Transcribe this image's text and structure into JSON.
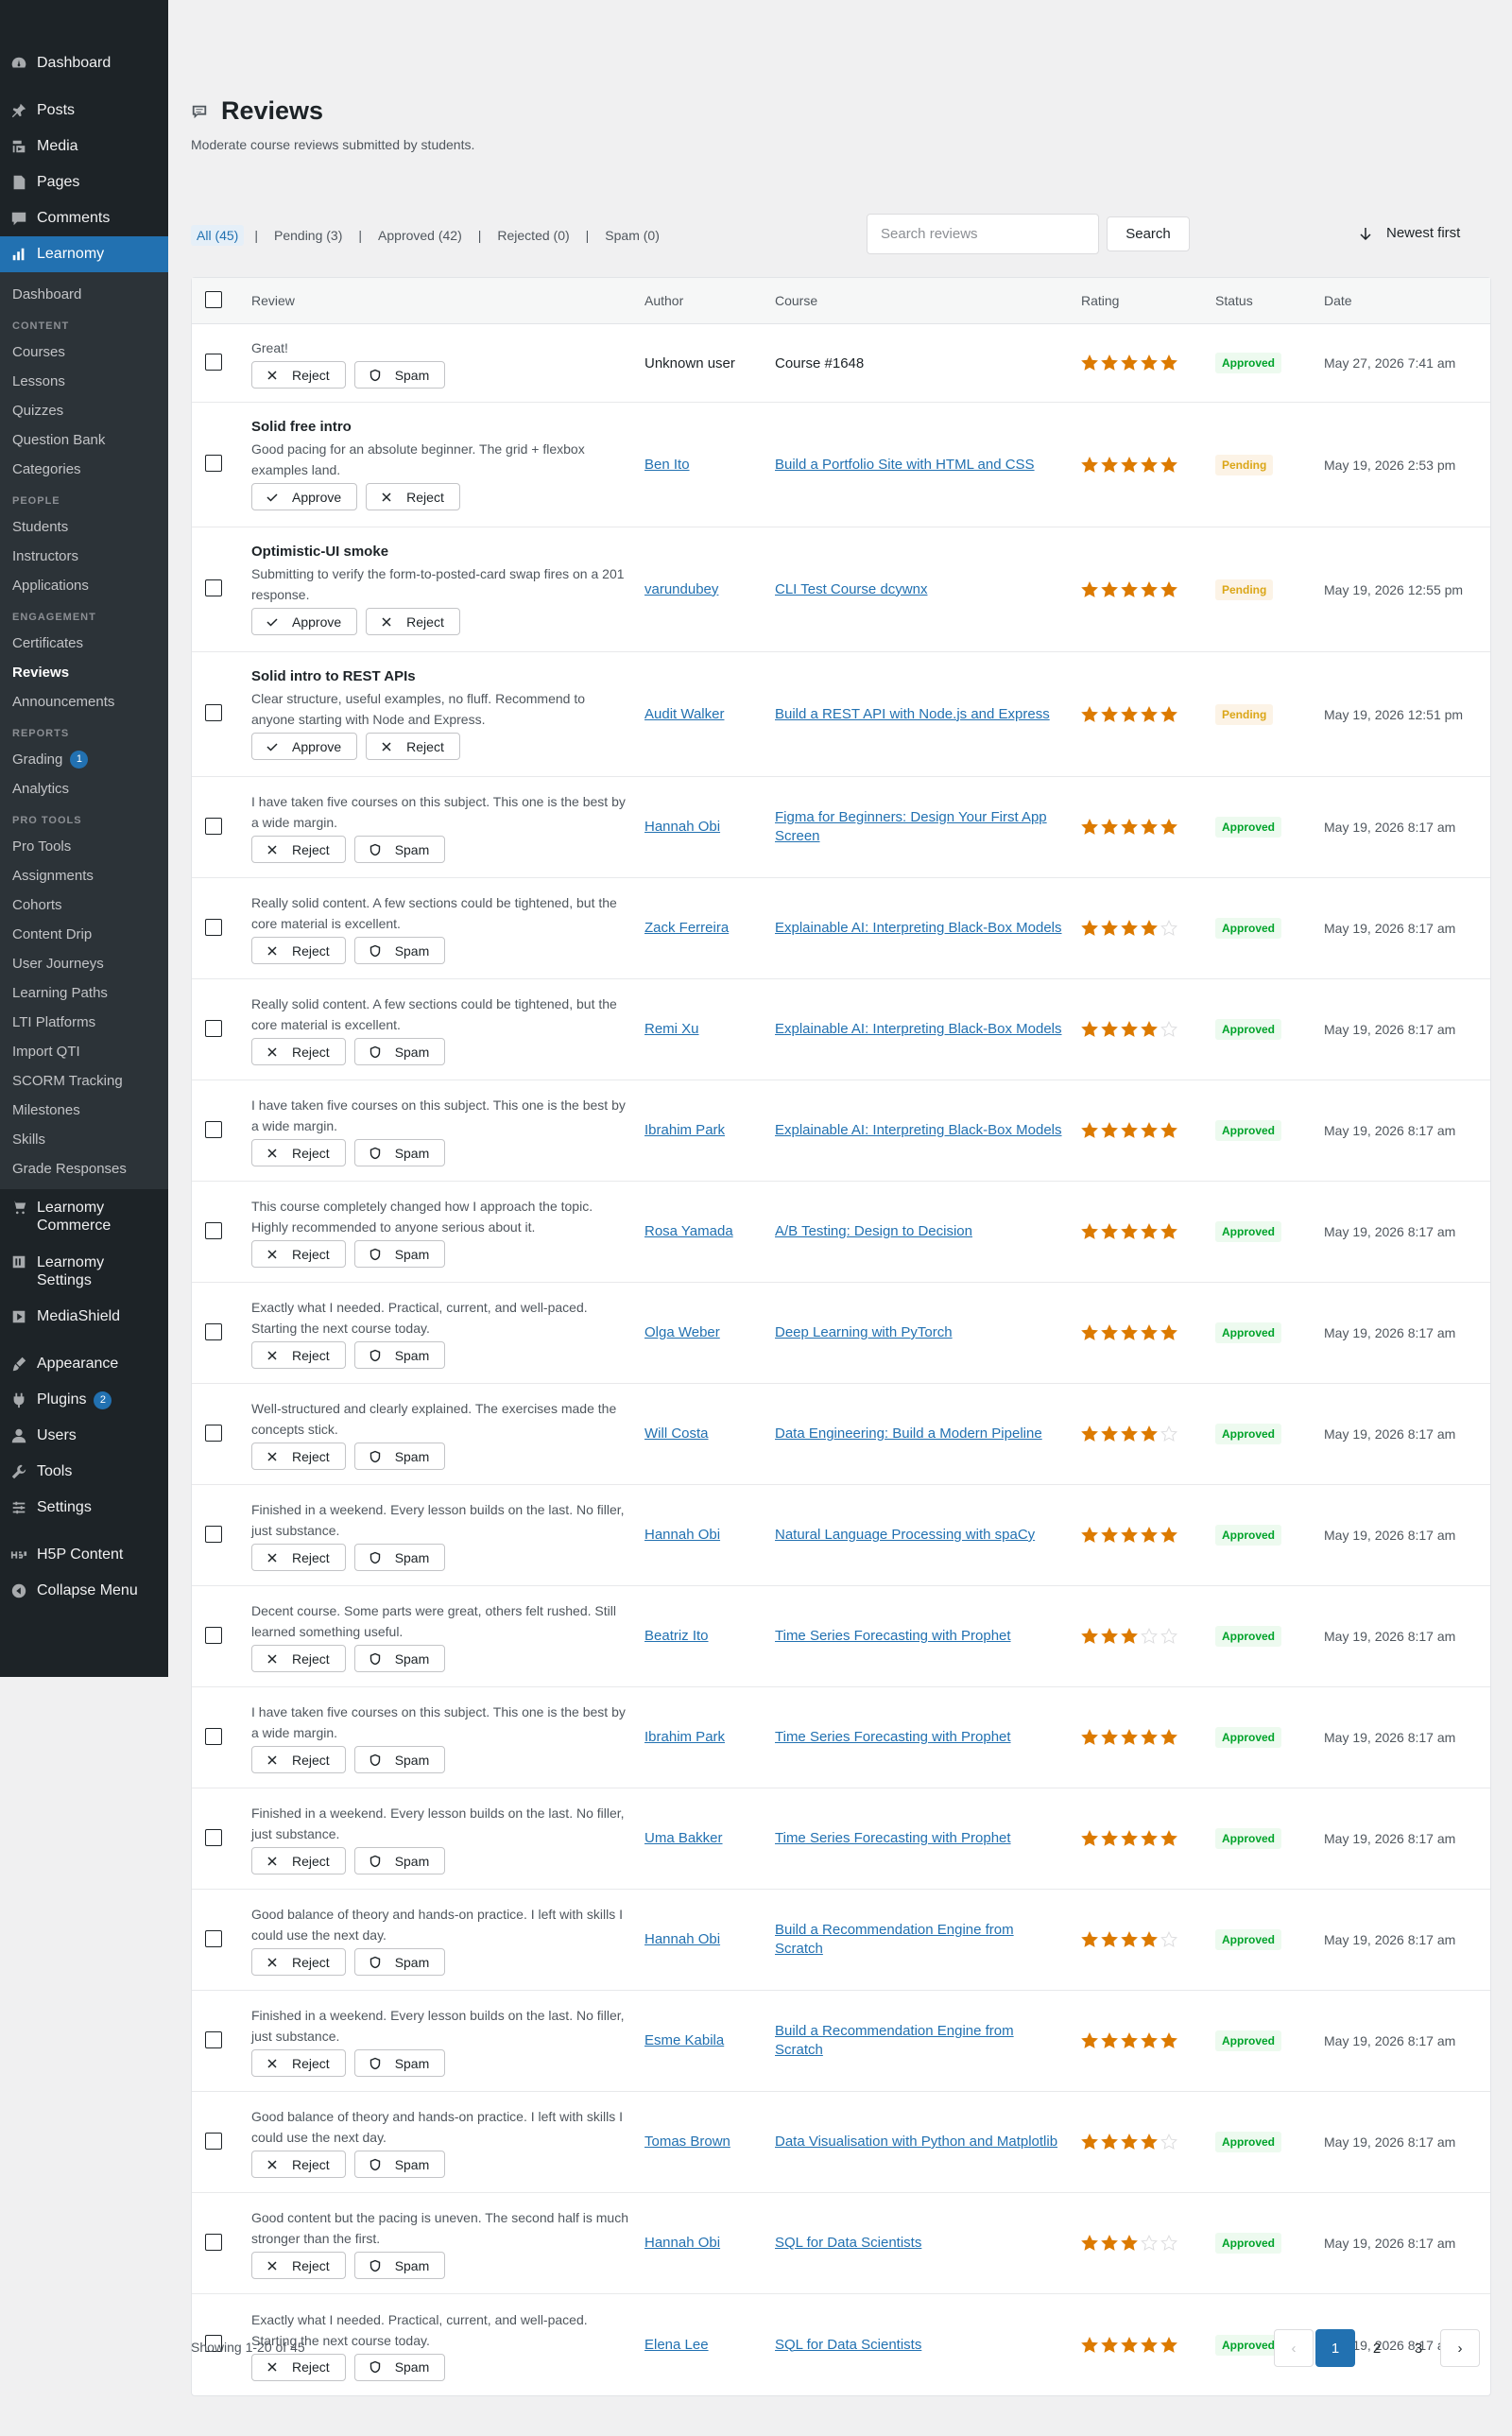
{
  "sidebar": {
    "top_items": [
      {
        "label": "Dashboard",
        "icon": "dashboard-icon"
      },
      {
        "label": "Posts",
        "icon": "pin-icon"
      },
      {
        "label": "Media",
        "icon": "media-icon"
      },
      {
        "label": "Pages",
        "icon": "page-icon"
      },
      {
        "label": "Comments",
        "icon": "comment-icon"
      }
    ],
    "active_item": {
      "label": "Learnomy",
      "icon": "chart-icon"
    },
    "submenu": {
      "dashboard": "Dashboard",
      "content_head": "CONTENT",
      "content": [
        "Courses",
        "Lessons",
        "Quizzes",
        "Question Bank",
        "Categories"
      ],
      "people_head": "PEOPLE",
      "people": [
        "Students",
        "Instructors",
        "Applications"
      ],
      "engagement_head": "ENGAGEMENT",
      "engagement": [
        "Certificates",
        "Reviews",
        "Announcements"
      ],
      "reports_head": "REPORTS",
      "grading": "Grading",
      "grading_count": "1",
      "analytics": "Analytics",
      "protools_head": "PRO TOOLS",
      "protools": [
        "Pro Tools",
        "Assignments",
        "Cohorts",
        "Content Drip",
        "User Journeys",
        "Learning Paths",
        "LTI Platforms",
        "Import QTI",
        "SCORM Tracking",
        "Milestones",
        "Skills",
        "Grade Responses"
      ]
    },
    "after_items": [
      {
        "label": "Learnomy Commerce",
        "icon": "cart-icon"
      },
      {
        "label": "Learnomy Settings",
        "icon": "settings-box-icon"
      },
      {
        "label": "MediaShield",
        "icon": "play-box-icon"
      }
    ],
    "admin_items": [
      {
        "label": "Appearance",
        "icon": "brush-icon"
      },
      {
        "label": "Plugins",
        "icon": "plug-icon",
        "count": "2"
      },
      {
        "label": "Users",
        "icon": "user-icon"
      },
      {
        "label": "Tools",
        "icon": "wrench-icon"
      },
      {
        "label": "Settings",
        "icon": "sliders-icon"
      }
    ],
    "h5p": "H5P Content",
    "collapse": "Collapse Menu"
  },
  "page": {
    "title": "Reviews",
    "subtitle": "Moderate course reviews submitted by students."
  },
  "filters": [
    {
      "label": "All (45)",
      "active": true
    },
    {
      "label": "Pending (3)"
    },
    {
      "label": "Approved (42)"
    },
    {
      "label": "Rejected (0)"
    },
    {
      "label": "Spam (0)"
    }
  ],
  "search": {
    "placeholder": "Search reviews",
    "button": "Search"
  },
  "sort": {
    "label": "Newest first"
  },
  "table": {
    "headers": {
      "review": "Review",
      "author": "Author",
      "course": "Course",
      "rating": "Rating",
      "status": "Status",
      "date": "Date"
    },
    "rows": [
      {
        "title": "",
        "body": "Great!",
        "actions": [
          "Reject",
          "Spam"
        ],
        "author": "Unknown user",
        "author_link": false,
        "course": "Course #1648",
        "course_link": false,
        "rating": 5,
        "status": "Approved",
        "date": "May 27, 2026 7:41 am"
      },
      {
        "title": "Solid free intro",
        "body": "Good pacing for an absolute beginner. The grid + flexbox examples land.",
        "actions": [
          "Approve",
          "Reject"
        ],
        "author": "Ben Ito",
        "author_link": true,
        "course": "Build a Portfolio Site with HTML and CSS",
        "course_link": true,
        "rating": 5,
        "status": "Pending",
        "date": "May 19, 2026 2:53 pm"
      },
      {
        "title": "Optimistic-UI smoke",
        "body": "Submitting to verify the form-to-posted-card swap fires on a 201 response.",
        "actions": [
          "Approve",
          "Reject"
        ],
        "author": "varundubey",
        "author_link": true,
        "course": "CLI Test Course dcywnx",
        "course_link": true,
        "rating": 5,
        "status": "Pending",
        "date": "May 19, 2026 12:55 pm"
      },
      {
        "title": "Solid intro to REST APIs",
        "body": "Clear structure, useful examples, no fluff. Recommend to anyone starting with Node and Express.",
        "actions": [
          "Approve",
          "Reject"
        ],
        "author": "Audit Walker",
        "author_link": true,
        "course": "Build a REST API with Node.js and Express",
        "course_link": true,
        "rating": 5,
        "status": "Pending",
        "date": "May 19, 2026 12:51 pm"
      },
      {
        "title": "",
        "body": "I have taken five courses on this subject. This one is the best by a wide margin.",
        "actions": [
          "Reject",
          "Spam"
        ],
        "author": "Hannah Obi",
        "author_link": true,
        "course": "Figma for Beginners: Design Your First App Screen",
        "course_link": true,
        "rating": 5,
        "status": "Approved",
        "date": "May 19, 2026 8:17 am"
      },
      {
        "title": "",
        "body": "Really solid content. A few sections could be tightened, but the core material is excellent.",
        "actions": [
          "Reject",
          "Spam"
        ],
        "author": "Zack Ferreira",
        "author_link": true,
        "course": "Explainable AI: Interpreting Black-Box Models",
        "course_link": true,
        "rating": 4,
        "status": "Approved",
        "date": "May 19, 2026 8:17 am"
      },
      {
        "title": "",
        "body": "Really solid content. A few sections could be tightened, but the core material is excellent.",
        "actions": [
          "Reject",
          "Spam"
        ],
        "author": "Remi Xu",
        "author_link": true,
        "course": "Explainable AI: Interpreting Black-Box Models",
        "course_link": true,
        "rating": 4,
        "status": "Approved",
        "date": "May 19, 2026 8:17 am"
      },
      {
        "title": "",
        "body": "I have taken five courses on this subject. This one is the best by a wide margin.",
        "actions": [
          "Reject",
          "Spam"
        ],
        "author": "Ibrahim Park",
        "author_link": true,
        "course": "Explainable AI: Interpreting Black-Box Models",
        "course_link": true,
        "rating": 5,
        "status": "Approved",
        "date": "May 19, 2026 8:17 am"
      },
      {
        "title": "",
        "body": "This course completely changed how I approach the topic. Highly recommended to anyone serious about it.",
        "actions": [
          "Reject",
          "Spam"
        ],
        "author": "Rosa Yamada",
        "author_link": true,
        "course": "A/B Testing: Design to Decision",
        "course_link": true,
        "rating": 5,
        "status": "Approved",
        "date": "May 19, 2026 8:17 am"
      },
      {
        "title": "",
        "body": "Exactly what I needed. Practical, current, and well-paced. Starting the next course today.",
        "actions": [
          "Reject",
          "Spam"
        ],
        "author": "Olga Weber",
        "author_link": true,
        "course": "Deep Learning with PyTorch",
        "course_link": true,
        "rating": 5,
        "status": "Approved",
        "date": "May 19, 2026 8:17 am"
      },
      {
        "title": "",
        "body": "Well-structured and clearly explained. The exercises made the concepts stick.",
        "actions": [
          "Reject",
          "Spam"
        ],
        "author": "Will Costa",
        "author_link": true,
        "course": "Data Engineering: Build a Modern Pipeline",
        "course_link": true,
        "rating": 4,
        "status": "Approved",
        "date": "May 19, 2026 8:17 am"
      },
      {
        "title": "",
        "body": "Finished in a weekend. Every lesson builds on the last. No filler, just substance.",
        "actions": [
          "Reject",
          "Spam"
        ],
        "author": "Hannah Obi",
        "author_link": true,
        "course": "Natural Language Processing with spaCy",
        "course_link": true,
        "rating": 5,
        "status": "Approved",
        "date": "May 19, 2026 8:17 am"
      },
      {
        "title": "",
        "body": "Decent course. Some parts were great, others felt rushed. Still learned something useful.",
        "actions": [
          "Reject",
          "Spam"
        ],
        "author": "Beatriz Ito",
        "author_link": true,
        "course": "Time Series Forecasting with Prophet",
        "course_link": true,
        "rating": 3,
        "status": "Approved",
        "date": "May 19, 2026 8:17 am"
      },
      {
        "title": "",
        "body": "I have taken five courses on this subject. This one is the best by a wide margin.",
        "actions": [
          "Reject",
          "Spam"
        ],
        "author": "Ibrahim Park",
        "author_link": true,
        "course": "Time Series Forecasting with Prophet",
        "course_link": true,
        "rating": 5,
        "status": "Approved",
        "date": "May 19, 2026 8:17 am"
      },
      {
        "title": "",
        "body": "Finished in a weekend. Every lesson builds on the last. No filler, just substance.",
        "actions": [
          "Reject",
          "Spam"
        ],
        "author": "Uma Bakker",
        "author_link": true,
        "course": "Time Series Forecasting with Prophet",
        "course_link": true,
        "rating": 5,
        "status": "Approved",
        "date": "May 19, 2026 8:17 am"
      },
      {
        "title": "",
        "body": "Good balance of theory and hands-on practice. I left with skills I could use the next day.",
        "actions": [
          "Reject",
          "Spam"
        ],
        "author": "Hannah Obi",
        "author_link": true,
        "course": "Build a Recommendation Engine from Scratch",
        "course_link": true,
        "rating": 4,
        "status": "Approved",
        "date": "May 19, 2026 8:17 am"
      },
      {
        "title": "",
        "body": "Finished in a weekend. Every lesson builds on the last. No filler, just substance.",
        "actions": [
          "Reject",
          "Spam"
        ],
        "author": "Esme Kabila",
        "author_link": true,
        "course": "Build a Recommendation Engine from Scratch",
        "course_link": true,
        "rating": 5,
        "status": "Approved",
        "date": "May 19, 2026 8:17 am"
      },
      {
        "title": "",
        "body": "Good balance of theory and hands-on practice. I left with skills I could use the next day.",
        "actions": [
          "Reject",
          "Spam"
        ],
        "author": "Tomas Brown",
        "author_link": true,
        "course": "Data Visualisation with Python and Matplotlib",
        "course_link": true,
        "rating": 4,
        "status": "Approved",
        "date": "May 19, 2026 8:17 am"
      },
      {
        "title": "",
        "body": "Good content but the pacing is uneven. The second half is much stronger than the first.",
        "actions": [
          "Reject",
          "Spam"
        ],
        "author": "Hannah Obi",
        "author_link": true,
        "course": "SQL for Data Scientists",
        "course_link": true,
        "rating": 3,
        "status": "Approved",
        "date": "May 19, 2026 8:17 am"
      },
      {
        "title": "",
        "body": "Exactly what I needed. Practical, current, and well-paced. Starting the next course today.",
        "actions": [
          "Reject",
          "Spam"
        ],
        "author": "Elena Lee",
        "author_link": true,
        "course": "SQL for Data Scientists",
        "course_link": true,
        "rating": 5,
        "status": "Approved",
        "date": "May 19, 2026 8:17 am"
      }
    ]
  },
  "footer": {
    "showing": "Showing 1-20 of 45",
    "pages": [
      "1",
      "2",
      "3"
    ],
    "current_page": "1",
    "prev": "‹",
    "next": "›"
  },
  "colors": {
    "accent": "#2271b1",
    "star": "#dc7a00",
    "star_empty": "#dcdcde",
    "approved": "#00a32a",
    "pending": "#dba617"
  }
}
